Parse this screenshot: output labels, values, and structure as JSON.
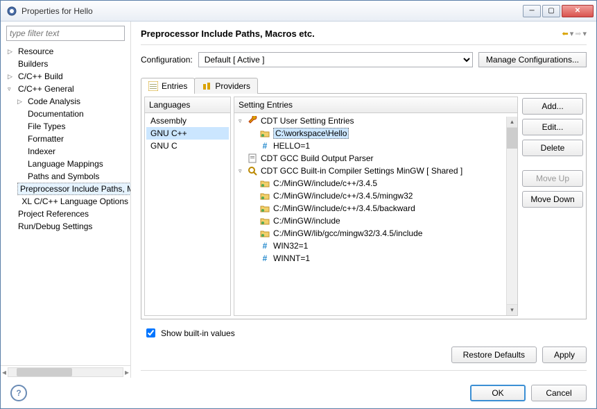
{
  "window": {
    "title": "Properties for Hello"
  },
  "filter": {
    "placeholder": "type filter text"
  },
  "tree": {
    "items": [
      {
        "label": "Resource",
        "indent": 0,
        "arrow": "▷"
      },
      {
        "label": "Builders",
        "indent": 0,
        "arrow": ""
      },
      {
        "label": "C/C++ Build",
        "indent": 0,
        "arrow": "▷"
      },
      {
        "label": "C/C++ General",
        "indent": 0,
        "arrow": "▿"
      },
      {
        "label": "Code Analysis",
        "indent": 1,
        "arrow": "▷"
      },
      {
        "label": "Documentation",
        "indent": 1,
        "arrow": ""
      },
      {
        "label": "File Types",
        "indent": 1,
        "arrow": ""
      },
      {
        "label": "Formatter",
        "indent": 1,
        "arrow": ""
      },
      {
        "label": "Indexer",
        "indent": 1,
        "arrow": ""
      },
      {
        "label": "Language Mappings",
        "indent": 1,
        "arrow": ""
      },
      {
        "label": "Paths and Symbols",
        "indent": 1,
        "arrow": ""
      },
      {
        "label": "Preprocessor Include Paths, Macros etc.",
        "indent": 1,
        "arrow": "",
        "selected": true
      },
      {
        "label": "XL C/C++ Language Options",
        "indent": 1,
        "arrow": ""
      },
      {
        "label": "Project References",
        "indent": 0,
        "arrow": ""
      },
      {
        "label": "Run/Debug Settings",
        "indent": 0,
        "arrow": ""
      }
    ]
  },
  "page": {
    "title": "Preprocessor Include Paths, Macros etc.",
    "configLabel": "Configuration:",
    "configValue": "Default  [ Active ]",
    "manageBtn": "Manage Configurations..."
  },
  "tabs": {
    "t0": "Entries",
    "t1": "Providers"
  },
  "langPanel": {
    "header": "Languages",
    "items": [
      "Assembly",
      "GNU C++",
      "GNU C"
    ],
    "selected": 1
  },
  "entriesPanel": {
    "header": "Setting Entries",
    "rows": [
      {
        "indent": 0,
        "arrow": "▿",
        "icon": "wrench",
        "text": "CDT User Setting Entries"
      },
      {
        "indent": 1,
        "arrow": "",
        "icon": "folder",
        "text": "C:\\workspace\\Hello",
        "selected": true
      },
      {
        "indent": 1,
        "arrow": "",
        "icon": "hash",
        "text": "HELLO=1"
      },
      {
        "indent": 0,
        "arrow": "",
        "icon": "doc",
        "text": "CDT GCC Build Output Parser"
      },
      {
        "indent": 0,
        "arrow": "▿",
        "icon": "search",
        "text": "CDT GCC Built-in Compiler Settings MinGW   [ Shared ]"
      },
      {
        "indent": 1,
        "arrow": "",
        "icon": "folder",
        "text": "C:/MinGW/include/c++/3.4.5"
      },
      {
        "indent": 1,
        "arrow": "",
        "icon": "folder",
        "text": "C:/MinGW/include/c++/3.4.5/mingw32"
      },
      {
        "indent": 1,
        "arrow": "",
        "icon": "folder",
        "text": "C:/MinGW/include/c++/3.4.5/backward"
      },
      {
        "indent": 1,
        "arrow": "",
        "icon": "folder",
        "text": "C:/MinGW/include"
      },
      {
        "indent": 1,
        "arrow": "",
        "icon": "folder",
        "text": "C:/MinGW/lib/gcc/mingw32/3.4.5/include"
      },
      {
        "indent": 1,
        "arrow": "",
        "icon": "hash",
        "text": "WIN32=1"
      },
      {
        "indent": 1,
        "arrow": "",
        "icon": "hash",
        "text": "WINNT=1"
      }
    ]
  },
  "buttons": {
    "add": "Add...",
    "edit": "Edit...",
    "delete": "Delete",
    "moveUp": "Move Up",
    "moveDown": "Move Down",
    "showBuiltin": "Show built-in values",
    "restore": "Restore Defaults",
    "apply": "Apply",
    "ok": "OK",
    "cancel": "Cancel"
  }
}
